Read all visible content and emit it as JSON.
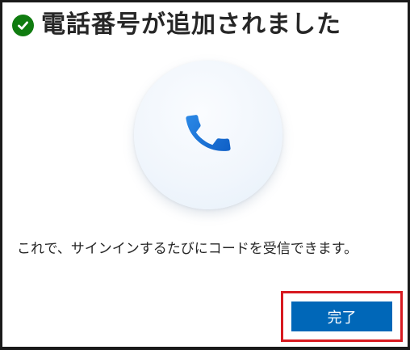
{
  "dialog": {
    "title": "電話番号が追加されました",
    "title_icon": "check-circle-icon",
    "illustration_icon": "phone-icon",
    "message": "これで、サインインするたびにコードを受信できます。",
    "done_button_label": "完了"
  },
  "colors": {
    "success_green": "#107c10",
    "accent_blue": "#0067b8",
    "phone_blue": "#1a73e8",
    "highlight_red": "#d71920",
    "text": "#262626"
  }
}
